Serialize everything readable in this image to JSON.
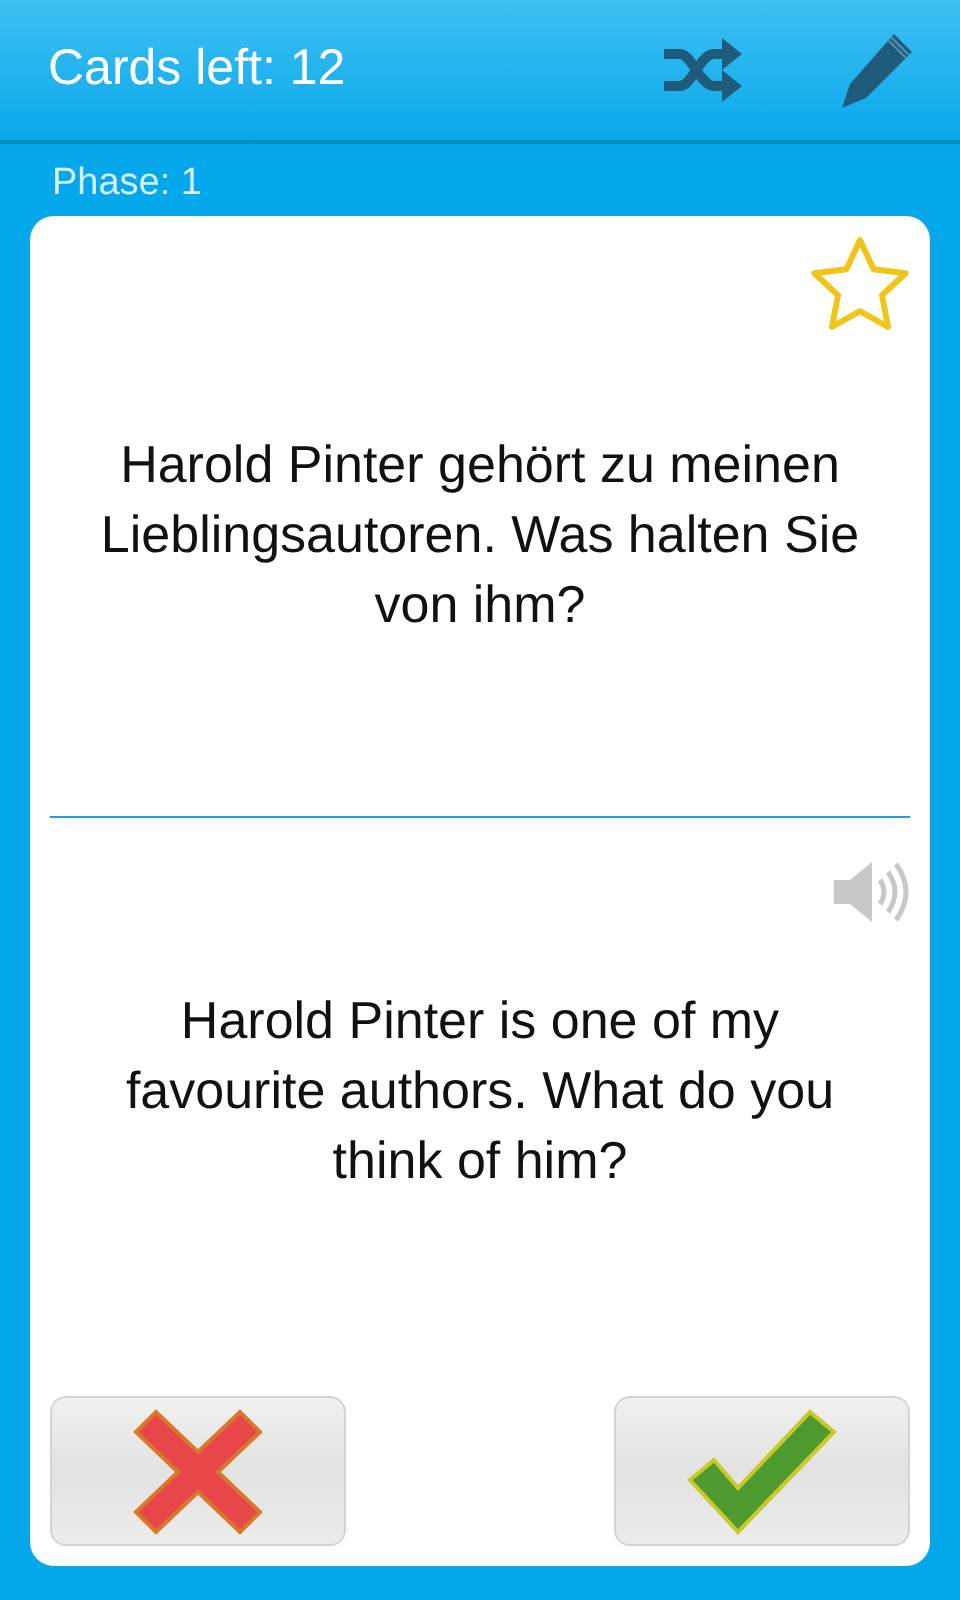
{
  "header": {
    "title": "Cards left: 12"
  },
  "phase": "Phase: 1",
  "card": {
    "favorite": false,
    "question": "Harold Pinter gehört zu meinen Lieblingsautoren. Was halten Sie von ihm?",
    "answer": "Harold Pinter is one of my favourite authors. What do you think of him?"
  }
}
